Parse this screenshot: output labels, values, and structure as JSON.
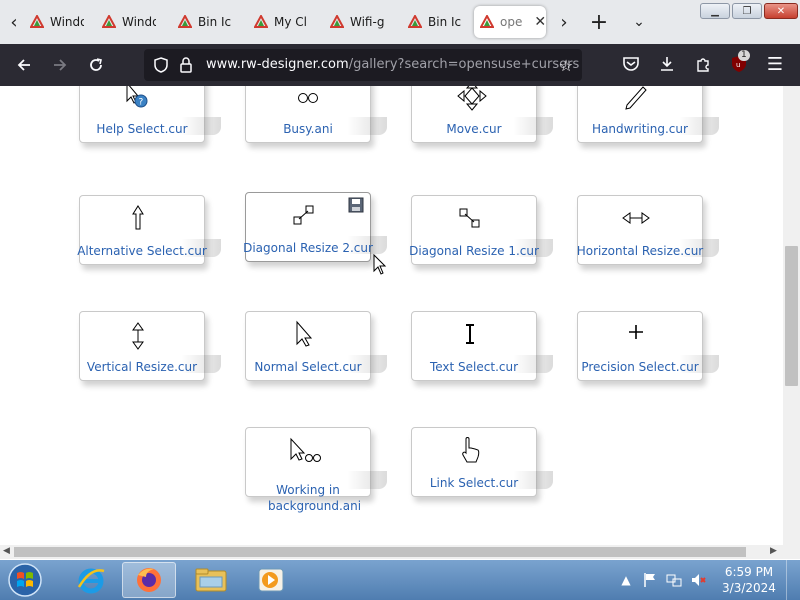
{
  "browser": {
    "tabs": [
      {
        "title": "Windo",
        "active": false
      },
      {
        "title": "Windo",
        "active": false
      },
      {
        "title": "Bin Ic",
        "active": false
      },
      {
        "title": "My Cl",
        "active": false
      },
      {
        "title": "Wifi-g",
        "active": false
      },
      {
        "title": "Bin Ic",
        "active": false
      },
      {
        "title": "ope",
        "active": true
      }
    ],
    "url_host": "www.rw-designer.com",
    "url_path": "/gallery?search=opensuse+cursors",
    "ublock_badge": "1"
  },
  "gallery": {
    "items": [
      {
        "label": "Help Select.cur",
        "icon": "help-select-cursor-icon"
      },
      {
        "label": "Busy.ani",
        "icon": "busy-cursor-icon"
      },
      {
        "label": "Move.cur",
        "icon": "move-cursor-icon"
      },
      {
        "label": "Handwriting.cur",
        "icon": "handwriting-cursor-icon"
      },
      {
        "label": "Alternative Select.cur",
        "icon": "alternative-select-cursor-icon"
      },
      {
        "label": "Diagonal Resize 2.cur",
        "icon": "diagonal-resize-2-cursor-icon"
      },
      {
        "label": "Diagonal Resize 1.cur",
        "icon": "diagonal-resize-1-cursor-icon"
      },
      {
        "label": "Horizontal Resize.cur",
        "icon": "horizontal-resize-cursor-icon"
      },
      {
        "label": "Vertical Resize.cur",
        "icon": "vertical-resize-cursor-icon"
      },
      {
        "label": "Normal Select.cur",
        "icon": "normal-select-cursor-icon"
      },
      {
        "label": "Text Select.cur",
        "icon": "text-select-cursor-icon"
      },
      {
        "label": "Precision Select.cur",
        "icon": "precision-select-cursor-icon"
      },
      {
        "label": "Working in background.ani",
        "icon": "working-in-background-cursor-icon"
      },
      {
        "label": "Link Select.cur",
        "icon": "link-select-cursor-icon"
      }
    ]
  },
  "taskbar": {
    "time": "6:59 PM",
    "date": "3/3/2024"
  },
  "colors": {
    "link": "#2b62b1",
    "navbar": "#2b2a33",
    "tabstrip": "#e7e9ec",
    "taskbar": "#5a88bb"
  }
}
